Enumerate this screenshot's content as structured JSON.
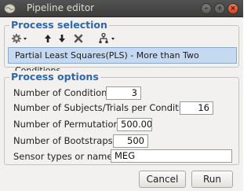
{
  "window": {
    "title": "Pipeline editor"
  },
  "process_selection": {
    "title": "Process selection",
    "toolbar": {
      "icons": [
        "gear-icon",
        "arrow-up-icon",
        "arrow-down-icon",
        "delete-icon",
        "pipeline-icon"
      ]
    },
    "selected_process": "Partial Least Squares(PLS) - More than Two Conditions"
  },
  "process_options": {
    "title": "Process options",
    "fields": {
      "num_conditions": {
        "label": "Number of Conditions:",
        "value": "3"
      },
      "num_subjects": {
        "label": "Number of Subjects/Trials per Condition:",
        "value": "16"
      },
      "num_permutations": {
        "label": "Number of Permutations:",
        "value": "500.00"
      },
      "num_bootstraps": {
        "label": "Number of Bootstraps:",
        "value": "500"
      },
      "sensor_types": {
        "label": "Sensor types or names:",
        "value": "MEG"
      }
    }
  },
  "buttons": {
    "cancel": "Cancel",
    "run": "Run"
  },
  "colors": {
    "section_title": "#2e67b1",
    "selection_bg": "#c5d9f1",
    "close_button": "#e25a2c"
  }
}
